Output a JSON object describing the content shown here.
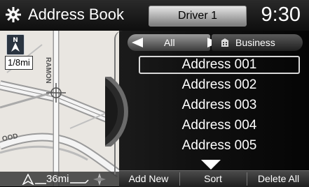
{
  "header": {
    "title": "Address Book",
    "driver": "Driver 1",
    "clock": "9:30"
  },
  "map": {
    "scale": "1/8mi",
    "road_name": "RAMON",
    "road_label_2": "OOD",
    "distance": "36mi"
  },
  "tabs": {
    "all_label": "All",
    "business_label": "Business"
  },
  "addresses": [
    {
      "label": "Address 001",
      "selected": true
    },
    {
      "label": "Address 002",
      "selected": false
    },
    {
      "label": "Address 003",
      "selected": false
    },
    {
      "label": "Address 004",
      "selected": false
    },
    {
      "label": "Address 005",
      "selected": false
    }
  ],
  "footer": {
    "add_new": "Add New",
    "sort": "Sort",
    "delete_all": "Delete All"
  },
  "colors": {
    "panel_bg": "#101010",
    "map_bg": "#e9e6e1",
    "text": "#ffffff"
  },
  "icons": [
    "gear-icon",
    "north-up-icon",
    "left-arrow-icon",
    "right-arrow-icon",
    "business-icon",
    "scroll-down-icon",
    "compass-icon"
  ]
}
